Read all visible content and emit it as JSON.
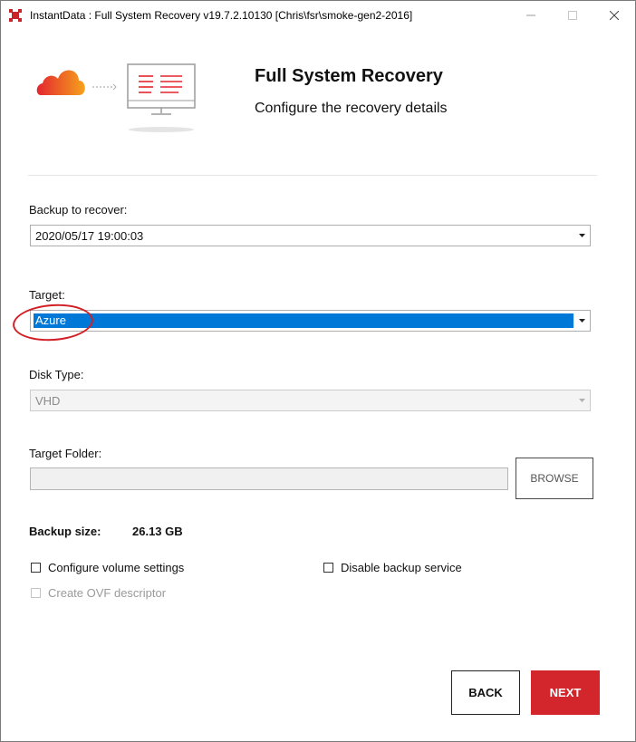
{
  "window": {
    "title": "InstantData : Full System Recovery v19.7.2.10130 [Chris\\fsr\\smoke-gen2-2016]",
    "minimize_glyph": "—",
    "maximize_glyph": "☐",
    "close_glyph": "✕"
  },
  "header": {
    "title": "Full System Recovery",
    "subtitle": "Configure the recovery details",
    "art_icons": [
      "cloud-icon",
      "monitor-icon"
    ]
  },
  "form": {
    "backup": {
      "label": "Backup to recover:",
      "value": "2020/05/17 19:00:03"
    },
    "target": {
      "label": "Target:",
      "value": "Azure"
    },
    "disk_type": {
      "label": "Disk Type:",
      "value": "VHD"
    },
    "target_folder": {
      "label": "Target Folder:",
      "value": "",
      "browse_label": "BROWSE"
    },
    "backup_size": {
      "label": "Backup size:",
      "value": "26.13 GB"
    },
    "options": {
      "configure_volume": {
        "label": "Configure volume settings",
        "checked": false
      },
      "disable_backup_service": {
        "label": "Disable backup service",
        "checked": false
      },
      "create_ovf": {
        "label": "Create OVF descriptor",
        "checked": false,
        "disabled": true
      }
    }
  },
  "footer": {
    "back_label": "BACK",
    "next_label": "NEXT"
  },
  "colors": {
    "accent": "#d2262c",
    "selection": "#0078d7",
    "cloud_gradient": [
      "#f6a21c",
      "#e3262f"
    ]
  }
}
